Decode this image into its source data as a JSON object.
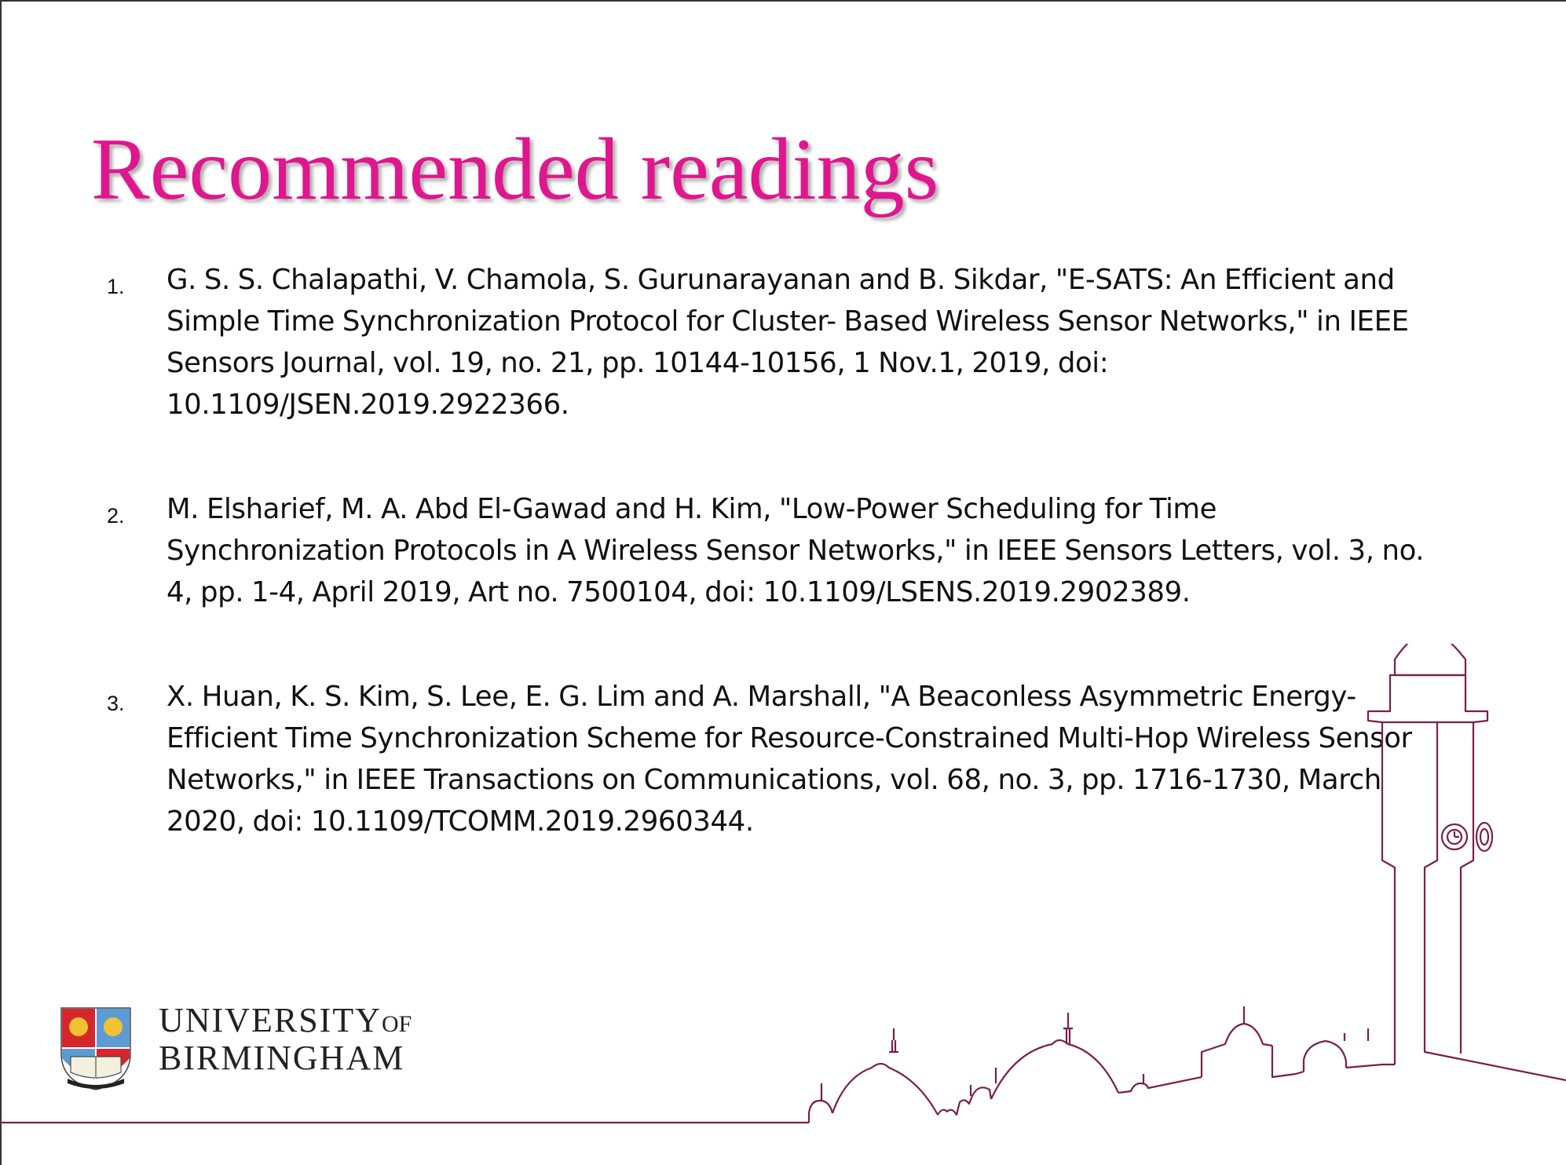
{
  "slide": {
    "title": "Recommended readings"
  },
  "references": [
    {
      "num": "1.",
      "text": "G. S. S. Chalapathi, V. Chamola, S. Gurunarayanan and B. Sikdar, \"E-SATS: An Efficient and Simple Time Synchronization Protocol for Cluster- Based Wireless Sensor Networks,\" in IEEE Sensors Journal, vol. 19, no. 21, pp. 10144-10156, 1 Nov.1, 2019, doi: 10.1109/JSEN.2019.2922366."
    },
    {
      "num": "2.",
      "text": "M. Elsharief, M. A. Abd El-Gawad and H. Kim, \"Low-Power Scheduling for Time Synchronization Protocols in A Wireless Sensor Networks,\" in IEEE Sensors Letters, vol. 3, no. 4, pp. 1-4, April 2019, Art no. 7500104, doi: 10.1109/LSENS.2019.2902389."
    },
    {
      "num": "3.",
      "text": "X. Huan, K. S. Kim, S. Lee, E. G. Lim and A. Marshall, \"A Beaconless Asymmetric Energy-Efficient Time Synchronization Scheme for Resource-Constrained Multi-Hop Wireless Sensor Networks,\" in IEEE Transactions on Communications, vol. 68, no. 3, pp. 1716-1730, March 2020, doi: 10.1109/TCOMM.2019.2960344."
    }
  ],
  "branding": {
    "university_line1": "UNIVERSITY",
    "university_of": "OF",
    "university_line2": "BIRMINGHAM"
  },
  "colors": {
    "title": "#e0168e",
    "skyline": "#7a1f4a",
    "text": "#111111"
  },
  "icons": {
    "logo": "university-crest-icon",
    "skyline": "birmingham-skyline-icon"
  }
}
